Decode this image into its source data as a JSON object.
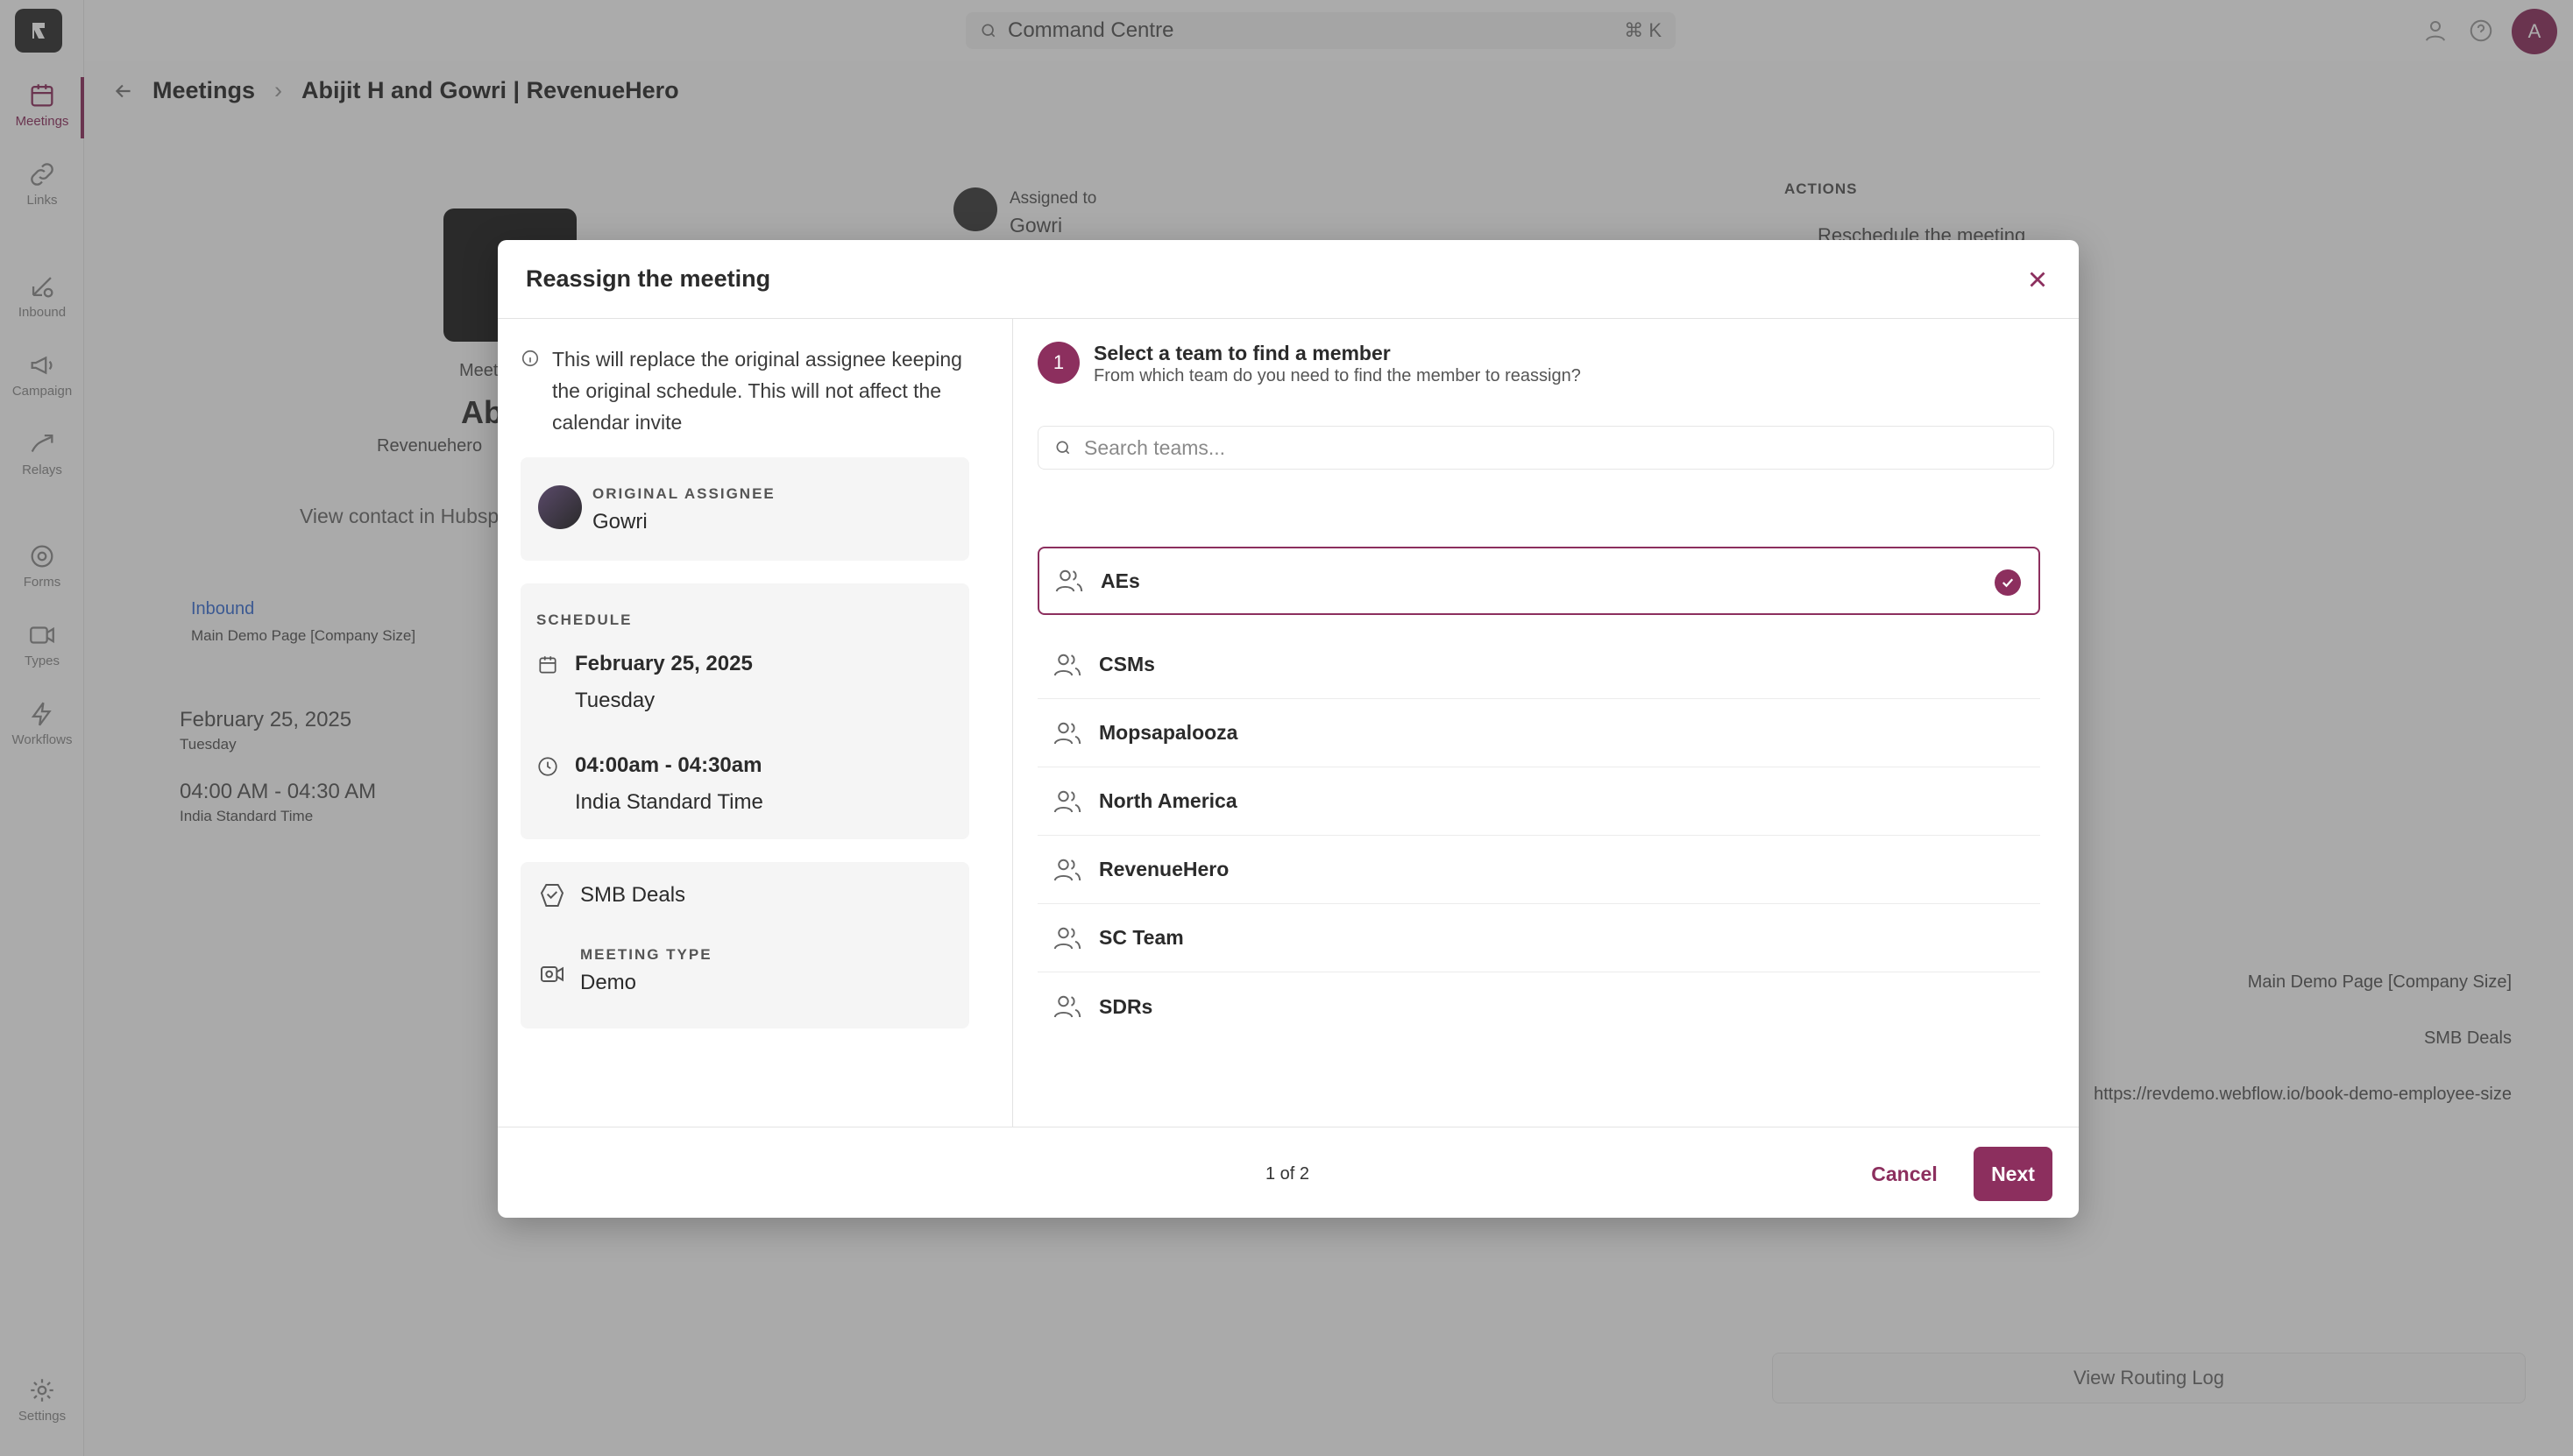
{
  "topbar": {
    "command_label": "Command Centre",
    "command_shortcut": "⌘ K",
    "avatar_initial": "A"
  },
  "sidebar": {
    "items": [
      {
        "label": "Meetings",
        "icon": "calendar-icon",
        "active": true
      },
      {
        "label": "Links",
        "icon": "link-icon"
      },
      {
        "label": "Inbound",
        "icon": "inbound-icon"
      },
      {
        "label": "Campaign",
        "icon": "megaphone-icon"
      },
      {
        "label": "Relays",
        "icon": "relay-icon"
      },
      {
        "label": "Forms",
        "icon": "form-icon"
      },
      {
        "label": "Types",
        "icon": "types-icon"
      },
      {
        "label": "Workflows",
        "icon": "bolt-icon"
      },
      {
        "label": "Settings",
        "icon": "gear-icon"
      }
    ]
  },
  "breadcrumb": {
    "parent": "Meetings",
    "current": "Abijit H and Gowri | RevenueHero"
  },
  "background": {
    "meeting_label": "Meet",
    "name_partial": "Ab",
    "company": "Revenuehero",
    "view_contact": "View contact in Hubsp",
    "source_label": "Inbound",
    "source_page": "Main Demo Page [Company Size]",
    "date": "February 25, 2025",
    "day": "Tuesday",
    "time": "04:00 AM - 04:30 AM",
    "timezone": "India Standard Time",
    "assigned_label": "Assigned to",
    "assigned_name": "Gowri",
    "actions_label": "ACTIONS",
    "reschedule": "Reschedule the meeting",
    "detail_page": "Main Demo Page [Company Size]",
    "detail_deals": "SMB Deals",
    "detail_url": "https://revdemo.webflow.io/book-demo-employee-size",
    "routing_log": "View Routing Log"
  },
  "modal": {
    "title": "Reassign the meeting",
    "info": "This will replace the original assignee keeping the original schedule. This will not affect the calendar invite",
    "original_assignee_label": "ORIGINAL ASSIGNEE",
    "original_assignee": "Gowri",
    "schedule_label": "SCHEDULE",
    "schedule_date": "February 25, 2025",
    "schedule_day": "Tuesday",
    "schedule_time": "04:00am - 04:30am",
    "schedule_tz": "India Standard Time",
    "deal": "SMB Deals",
    "meeting_type_label": "MEETING TYPE",
    "meeting_type": "Demo",
    "step_number": "1",
    "step_title": "Select a team to find a member",
    "step_subtitle": "From which team do you need to find the member to reassign?",
    "search_placeholder": "Search teams...",
    "teams": [
      {
        "name": "AEs",
        "selected": true
      },
      {
        "name": "CSMs"
      },
      {
        "name": "Mopsapalooza"
      },
      {
        "name": "North America"
      },
      {
        "name": "RevenueHero"
      },
      {
        "name": "SC Team"
      },
      {
        "name": "SDRs"
      }
    ],
    "pager": "1 of 2",
    "cancel_label": "Cancel",
    "next_label": "Next"
  },
  "colors": {
    "accent": "#8c2f5e"
  }
}
